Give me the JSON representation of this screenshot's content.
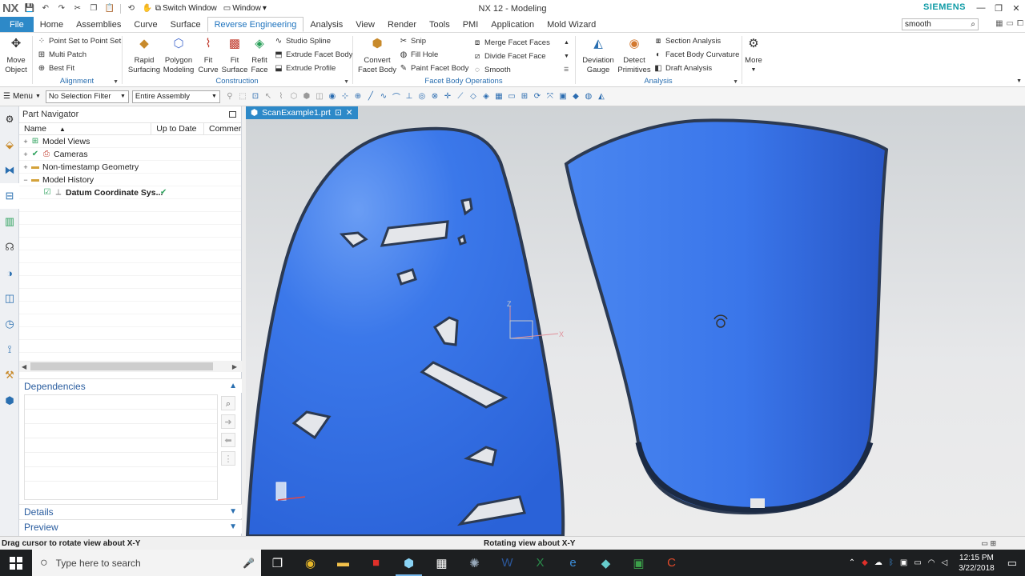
{
  "app": {
    "logo": "NX",
    "title": "NX 12 - Modeling",
    "brand": "SIEMENS",
    "switch_window": "Switch Window",
    "window_menu": "Window"
  },
  "tabs": [
    {
      "label": "File"
    },
    {
      "label": "Home"
    },
    {
      "label": "Assemblies"
    },
    {
      "label": "Curve"
    },
    {
      "label": "Surface"
    },
    {
      "label": "Reverse Engineering"
    },
    {
      "label": "Analysis"
    },
    {
      "label": "View"
    },
    {
      "label": "Render"
    },
    {
      "label": "Tools"
    },
    {
      "label": "PMI"
    },
    {
      "label": "Application"
    },
    {
      "label": "Mold Wizard"
    }
  ],
  "command_search": {
    "value": "smooth"
  },
  "ribbon": {
    "move_object": [
      "Move",
      "Object"
    ],
    "alignment": {
      "label": "Alignment",
      "items": [
        "Point Set to Point Set",
        "Multi Patch",
        "Best Fit"
      ]
    },
    "construction": {
      "label": "Construction",
      "rapid_surfacing": [
        "Rapid",
        "Surfacing"
      ],
      "polygon_modeling": [
        "Polygon",
        "Modeling"
      ],
      "fit_curve": [
        "Fit",
        "Curve"
      ],
      "fit_surface": [
        "Fit",
        "Surface"
      ],
      "refit_face": [
        "Refit",
        "Face"
      ],
      "items": [
        "Studio Spline",
        "Extrude Facet Body",
        "Extrude Profile"
      ]
    },
    "facet_ops": {
      "label": "Facet Body Operations",
      "convert": [
        "Convert",
        "Facet Body"
      ],
      "col1": [
        "Snip",
        "Fill Hole",
        "Paint Facet Body"
      ],
      "col2": [
        "Merge Facet Faces",
        "Divide Facet Face",
        "Smooth"
      ]
    },
    "analysis": {
      "label": "Analysis",
      "deviation": [
        "Deviation",
        "Gauge"
      ],
      "detect": [
        "Detect",
        "Primitives"
      ],
      "items": [
        "Section Analysis",
        "Facet Body Curvature",
        "Draft Analysis"
      ],
      "more": "More"
    }
  },
  "selection_bar": {
    "menu": "Menu",
    "filter": "No Selection Filter",
    "scope": "Entire Assembly"
  },
  "navigator": {
    "title": "Part Navigator",
    "columns": [
      "Name",
      "Up to Date",
      "Commer"
    ],
    "rows": [
      {
        "label": "Model Views",
        "icon": "model-views-icon"
      },
      {
        "label": "Cameras",
        "icon": "camera-icon"
      },
      {
        "label": "Non-timestamp Geometry",
        "icon": "folder-icon"
      },
      {
        "label": "Model History",
        "icon": "folder-open-icon"
      },
      {
        "label": "Datum Coordinate Sys...",
        "icon": "datum-csys-icon",
        "uptodate": "✔"
      }
    ],
    "dependencies": "Dependencies",
    "details": "Details",
    "preview": "Preview"
  },
  "graphics": {
    "file_tab": "ScanExample1.prt",
    "axis_z": "Z",
    "axis_x": "X",
    "body_color": "#3674e8",
    "edge_color": "#2c3a52"
  },
  "status": {
    "left": "Drag cursor to rotate view about X-Y",
    "middle": "Rotating view about X-Y"
  },
  "taskbar": {
    "search_placeholder": "Type here to search",
    "time": "12:15 PM",
    "date": "3/22/2018"
  }
}
